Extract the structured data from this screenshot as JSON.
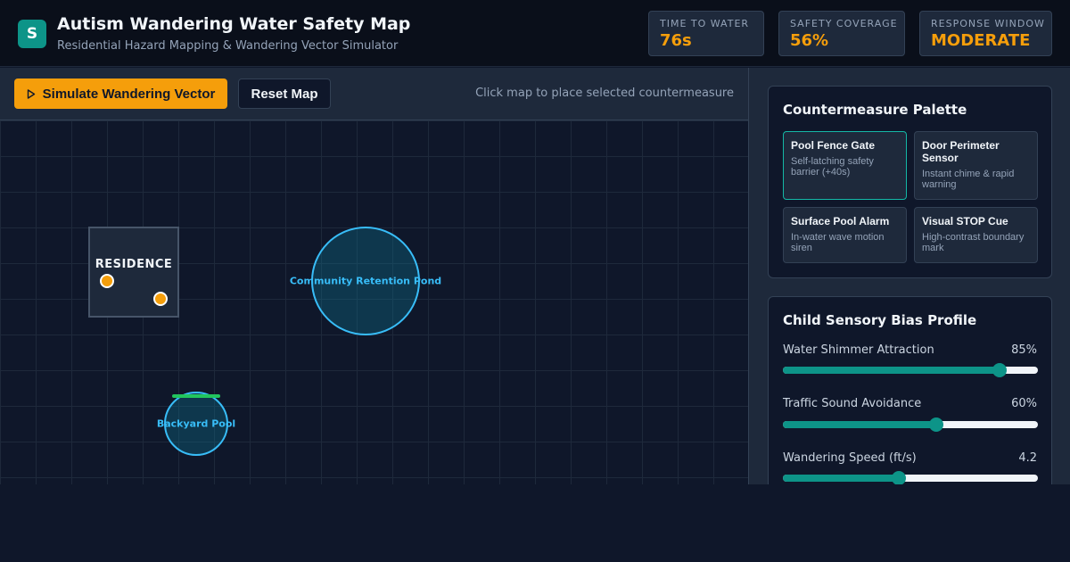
{
  "header": {
    "logo_letter": "S",
    "title": "Autism Wandering Water Safety Map",
    "subtitle": "Residential Hazard Mapping & Wandering Vector Simulator"
  },
  "metrics": [
    {
      "label": "TIME TO WATER",
      "value": "76s"
    },
    {
      "label": "SAFETY COVERAGE",
      "value": "56%"
    },
    {
      "label": "RESPONSE WINDOW",
      "value": "MODERATE"
    }
  ],
  "toolbar": {
    "simulate_label": "Simulate Wandering Vector",
    "simulate_icon": "play-icon",
    "reset_label": "Reset Map",
    "hint": "Click map to place selected countermeasure"
  },
  "map": {
    "residence_label": "RESIDENCE",
    "pond_label": "Community Retention Pond",
    "pool_label": "Backyard Pool"
  },
  "palette": {
    "title": "Countermeasure Palette",
    "items": [
      {
        "title": "Pool Fence Gate",
        "desc": "Self-latching safety barrier (+40s)",
        "selected": true
      },
      {
        "title": "Door Perimeter Sensor",
        "desc": "Instant chime & rapid warning",
        "selected": false
      },
      {
        "title": "Surface Pool Alarm",
        "desc": "In-water wave motion siren",
        "selected": false
      },
      {
        "title": "Visual STOP Cue",
        "desc": "High-contrast boundary mark",
        "selected": false
      }
    ]
  },
  "profile": {
    "title": "Child Sensory Bias Profile",
    "sliders": [
      {
        "label": "Water Shimmer Attraction",
        "display": "85%",
        "fraction": 0.85
      },
      {
        "label": "Traffic Sound Avoidance",
        "display": "60%",
        "fraction": 0.6
      },
      {
        "label": "Wandering Speed (ft/s)",
        "display": "4.2",
        "fraction": 0.455
      }
    ]
  },
  "colors": {
    "accent": "#f59e0b",
    "teal": "#0d9488",
    "water": "#38bdf8",
    "fence": "#22c55e"
  }
}
